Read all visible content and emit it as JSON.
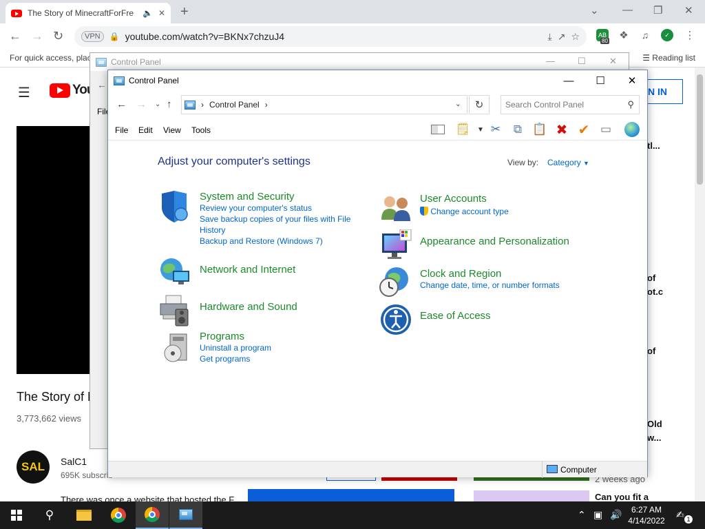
{
  "browser": {
    "tab_title": "The Story of MinecraftForFre",
    "url": "youtube.com/watch?v=BKNx7chzuJ4",
    "vpn_label": "VPN",
    "ext_badge": "80",
    "bookmarks_hint": "For quick access, place",
    "reading_list": "Reading list"
  },
  "youtube": {
    "logo_text": "You",
    "sign_in": "N IN",
    "video_title": "The Story of N",
    "views": "3,773,662 views",
    "channel_avatar": "SAL",
    "channel": "SalC1",
    "subscribers": "695K subscrib",
    "description": "There was once a website that hosted the F",
    "sidebar": [
      "tl...",
      "of",
      "ot.c",
      "of",
      "Old",
      "w...",
      "2 weeks ago",
      "Can you fit a"
    ]
  },
  "background_window": {
    "title": "Control Panel",
    "menu_frag": "File"
  },
  "control_panel": {
    "title": "Control Panel",
    "breadcrumb": "Control Panel",
    "search_placeholder": "Search Control Panel",
    "menu": {
      "file": "File",
      "edit": "Edit",
      "view": "View",
      "tools": "Tools"
    },
    "heading": "Adjust your computer's settings",
    "view_by_label": "View by:",
    "view_by_value": "Category",
    "categories": {
      "system_security": {
        "title": "System and Security",
        "links": [
          "Review your computer's status",
          "Save backup copies of your files with File History",
          "Backup and Restore (Windows 7)"
        ]
      },
      "network": {
        "title": "Network and Internet"
      },
      "hardware": {
        "title": "Hardware and Sound"
      },
      "programs": {
        "title": "Programs",
        "links": [
          "Uninstall a program",
          "Get programs"
        ]
      },
      "user_accounts": {
        "title": "User Accounts",
        "links": [
          "Change account type"
        ]
      },
      "appearance": {
        "title": "Appearance and Personalization"
      },
      "clock": {
        "title": "Clock and Region",
        "links": [
          "Change date, time, or number formats"
        ]
      },
      "ease": {
        "title": "Ease of Access"
      }
    },
    "status_computer": "Computer"
  },
  "taskbar": {
    "time": "6:27 AM",
    "date": "4/14/2022",
    "notif_count": "1"
  },
  "colors": {
    "link": "#0066cc",
    "category_title": "#1c8a2a",
    "heading": "#1e3287",
    "taskbar": "#1b1b1b"
  }
}
